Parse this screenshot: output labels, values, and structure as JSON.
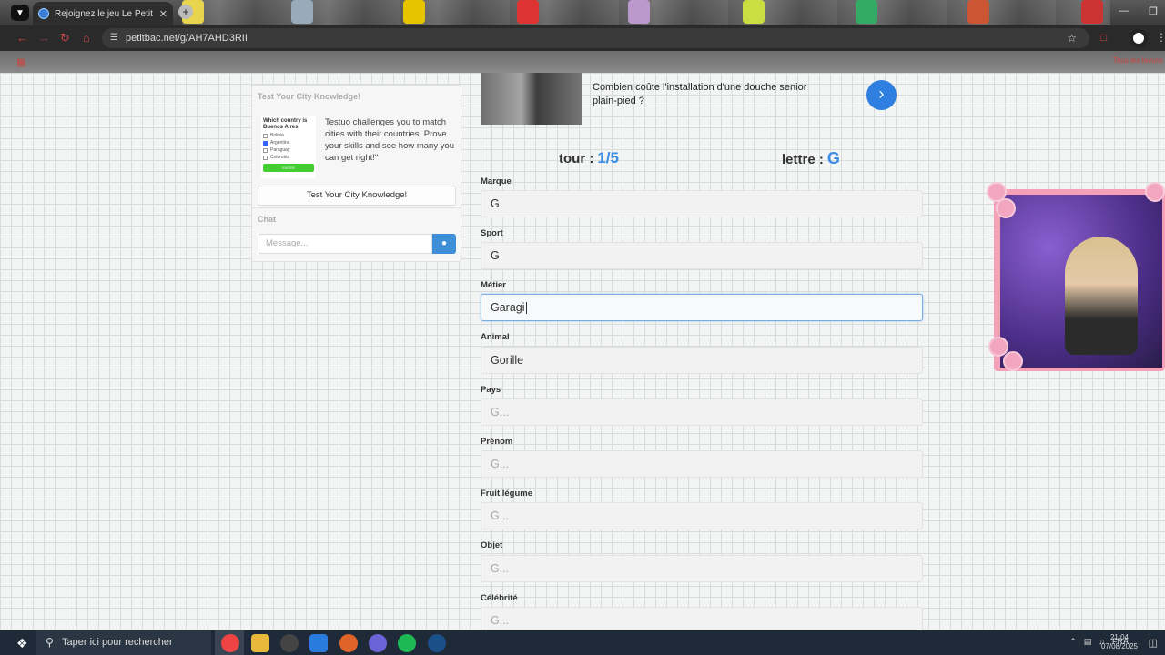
{
  "browser": {
    "tab_title": "Rejoignez le jeu Le Petit Bac",
    "url": "petitbac.net/g/AH7AHD3RII",
    "bookmarks_all": "Tous les favoris"
  },
  "quiz_widget": {
    "title": "Test Your City Knowledge!",
    "image_question": "Which country is Buenos Aires",
    "image_options": [
      "Bolivia",
      "Argentina",
      "Paraguay",
      "Colombia"
    ],
    "image_button": "ENTER",
    "description": "Testuo challenges you to match cities with their countries. Prove your skills and see how many you can get right!\"",
    "button_label": "Test Your City Knowledge!"
  },
  "chat": {
    "title": "Chat",
    "placeholder": "Message..."
  },
  "ad": {
    "text": "Combien coûte l'installation d'une douche senior plain-pied ?"
  },
  "game": {
    "round_label": "tour :",
    "round_value": "1/5",
    "letter_label": "lettre :",
    "letter_value": "G"
  },
  "fields": [
    {
      "label": "Marque",
      "value": "G"
    },
    {
      "label": "Sport",
      "value": "G"
    },
    {
      "label": "Métier",
      "value": "Garagi"
    },
    {
      "label": "Animal",
      "value": "Gorille"
    },
    {
      "label": "Pays",
      "placeholder": "G..."
    },
    {
      "label": "Prénom",
      "placeholder": "G..."
    },
    {
      "label": "Fruit légume",
      "placeholder": "G..."
    },
    {
      "label": "Objet",
      "placeholder": "G..."
    },
    {
      "label": "Célébrité",
      "placeholder": "G..."
    }
  ],
  "taskbar": {
    "search_placeholder": "Taper ici pour rechercher",
    "language": "FRA",
    "time": "21:04",
    "date": "07/08/2025"
  },
  "colors": {
    "accent": "#3a8ee6",
    "chat_send": "#3f8fd8",
    "ad_button": "#2f7fe0"
  }
}
